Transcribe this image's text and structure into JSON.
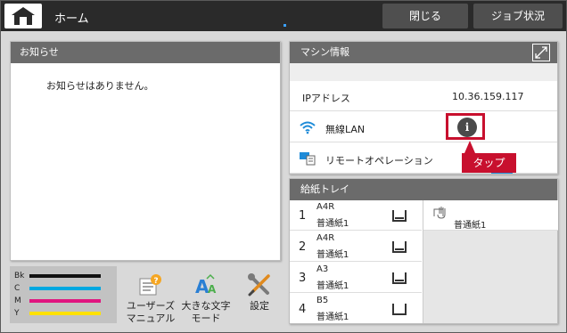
{
  "topbar": {
    "title": "ホーム",
    "close_label": "閉じる",
    "job_status_label": "ジョブ状況"
  },
  "notices": {
    "header": "お知らせ",
    "empty_message": "お知らせはありません。"
  },
  "toner": [
    {
      "label": "Bk",
      "color": "#111111"
    },
    {
      "label": "C",
      "color": "#00a8e0"
    },
    {
      "label": "M",
      "color": "#e0157f"
    },
    {
      "label": "Y",
      "color": "#ffe100"
    }
  ],
  "shortcuts": {
    "user_manual": [
      "ユーザーズ",
      "マニュアル"
    ],
    "large_text": [
      "大きな文字",
      "モード"
    ],
    "settings": "設定"
  },
  "machine_info": {
    "header": "マシン情報",
    "ip_label": "IPアドレス",
    "ip_value": "10.36.159.117",
    "wireless_label": "無線LAN",
    "info_glyph": "i",
    "remote_label": "リモートオペレーション"
  },
  "callout": {
    "label": "タップ",
    "color": "#c8102e"
  },
  "paper_tray": {
    "header": "給紙トレイ",
    "trays": [
      {
        "num": "1",
        "size": "A4R",
        "type": "普通紙1"
      },
      {
        "num": "2",
        "size": "A4R",
        "type": "普通紙1"
      },
      {
        "num": "3",
        "size": "A3",
        "type": "普通紙1"
      },
      {
        "num": "4",
        "size": "B5",
        "type": "普通紙1"
      }
    ],
    "bypass_type": "普通紙1"
  }
}
